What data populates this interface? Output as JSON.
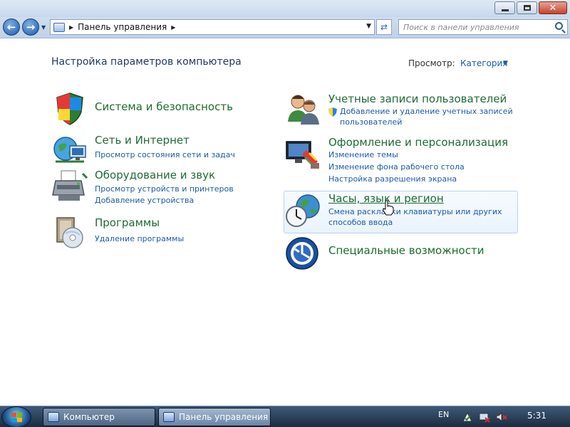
{
  "window": {
    "minimize_label": "",
    "maximize_label": "",
    "close_label": "✕"
  },
  "navigation": {
    "back_icon": "arrow-left-icon",
    "forward_icon": "arrow-right-icon"
  },
  "address": {
    "segments": [
      "Панель управления"
    ],
    "path_label": "Панель управления"
  },
  "search": {
    "placeholder": "Поиск в панели управления"
  },
  "content": {
    "heading": "Настройка параметров компьютера",
    "view_by_label": "Просмотр:",
    "view_by_value": "Категория"
  },
  "categories": {
    "system": {
      "title": "Система и безопасность",
      "icon": "shield-icon"
    },
    "network": {
      "title": "Сеть и Интернет",
      "icon": "globe-network-icon",
      "links": [
        "Просмотр состояния сети и задач"
      ]
    },
    "hardware": {
      "title": "Оборудование и звук",
      "icon": "printer-icon",
      "links": [
        "Просмотр устройств и принтеров",
        "Добавление устройства"
      ]
    },
    "programs": {
      "title": "Программы",
      "icon": "programs-icon",
      "links": [
        "Удаление программы"
      ]
    },
    "accounts": {
      "title": "Учетные записи пользователей",
      "icon": "users-icon",
      "links": [
        "Добавление и удаление учетных записей",
        "пользователей"
      ]
    },
    "appearance": {
      "title": "Оформление и персонализация",
      "icon": "monitor-paint-icon",
      "links": [
        "Изменение темы",
        "Изменение фона рабочего стола",
        "Настройка разрешения экрана"
      ]
    },
    "clock": {
      "title": "Часы, язык и регион",
      "icon": "clock-globe-icon",
      "links": [
        "Смена раскладки клавиатуры или других",
        "способов ввода"
      ]
    },
    "access": {
      "title": "Специальные возможности",
      "icon": "ease-of-access-icon"
    }
  },
  "taskbar": {
    "buttons": [
      "Компьютер",
      "Панель управления"
    ],
    "language": "EN",
    "time": "5:31"
  }
}
